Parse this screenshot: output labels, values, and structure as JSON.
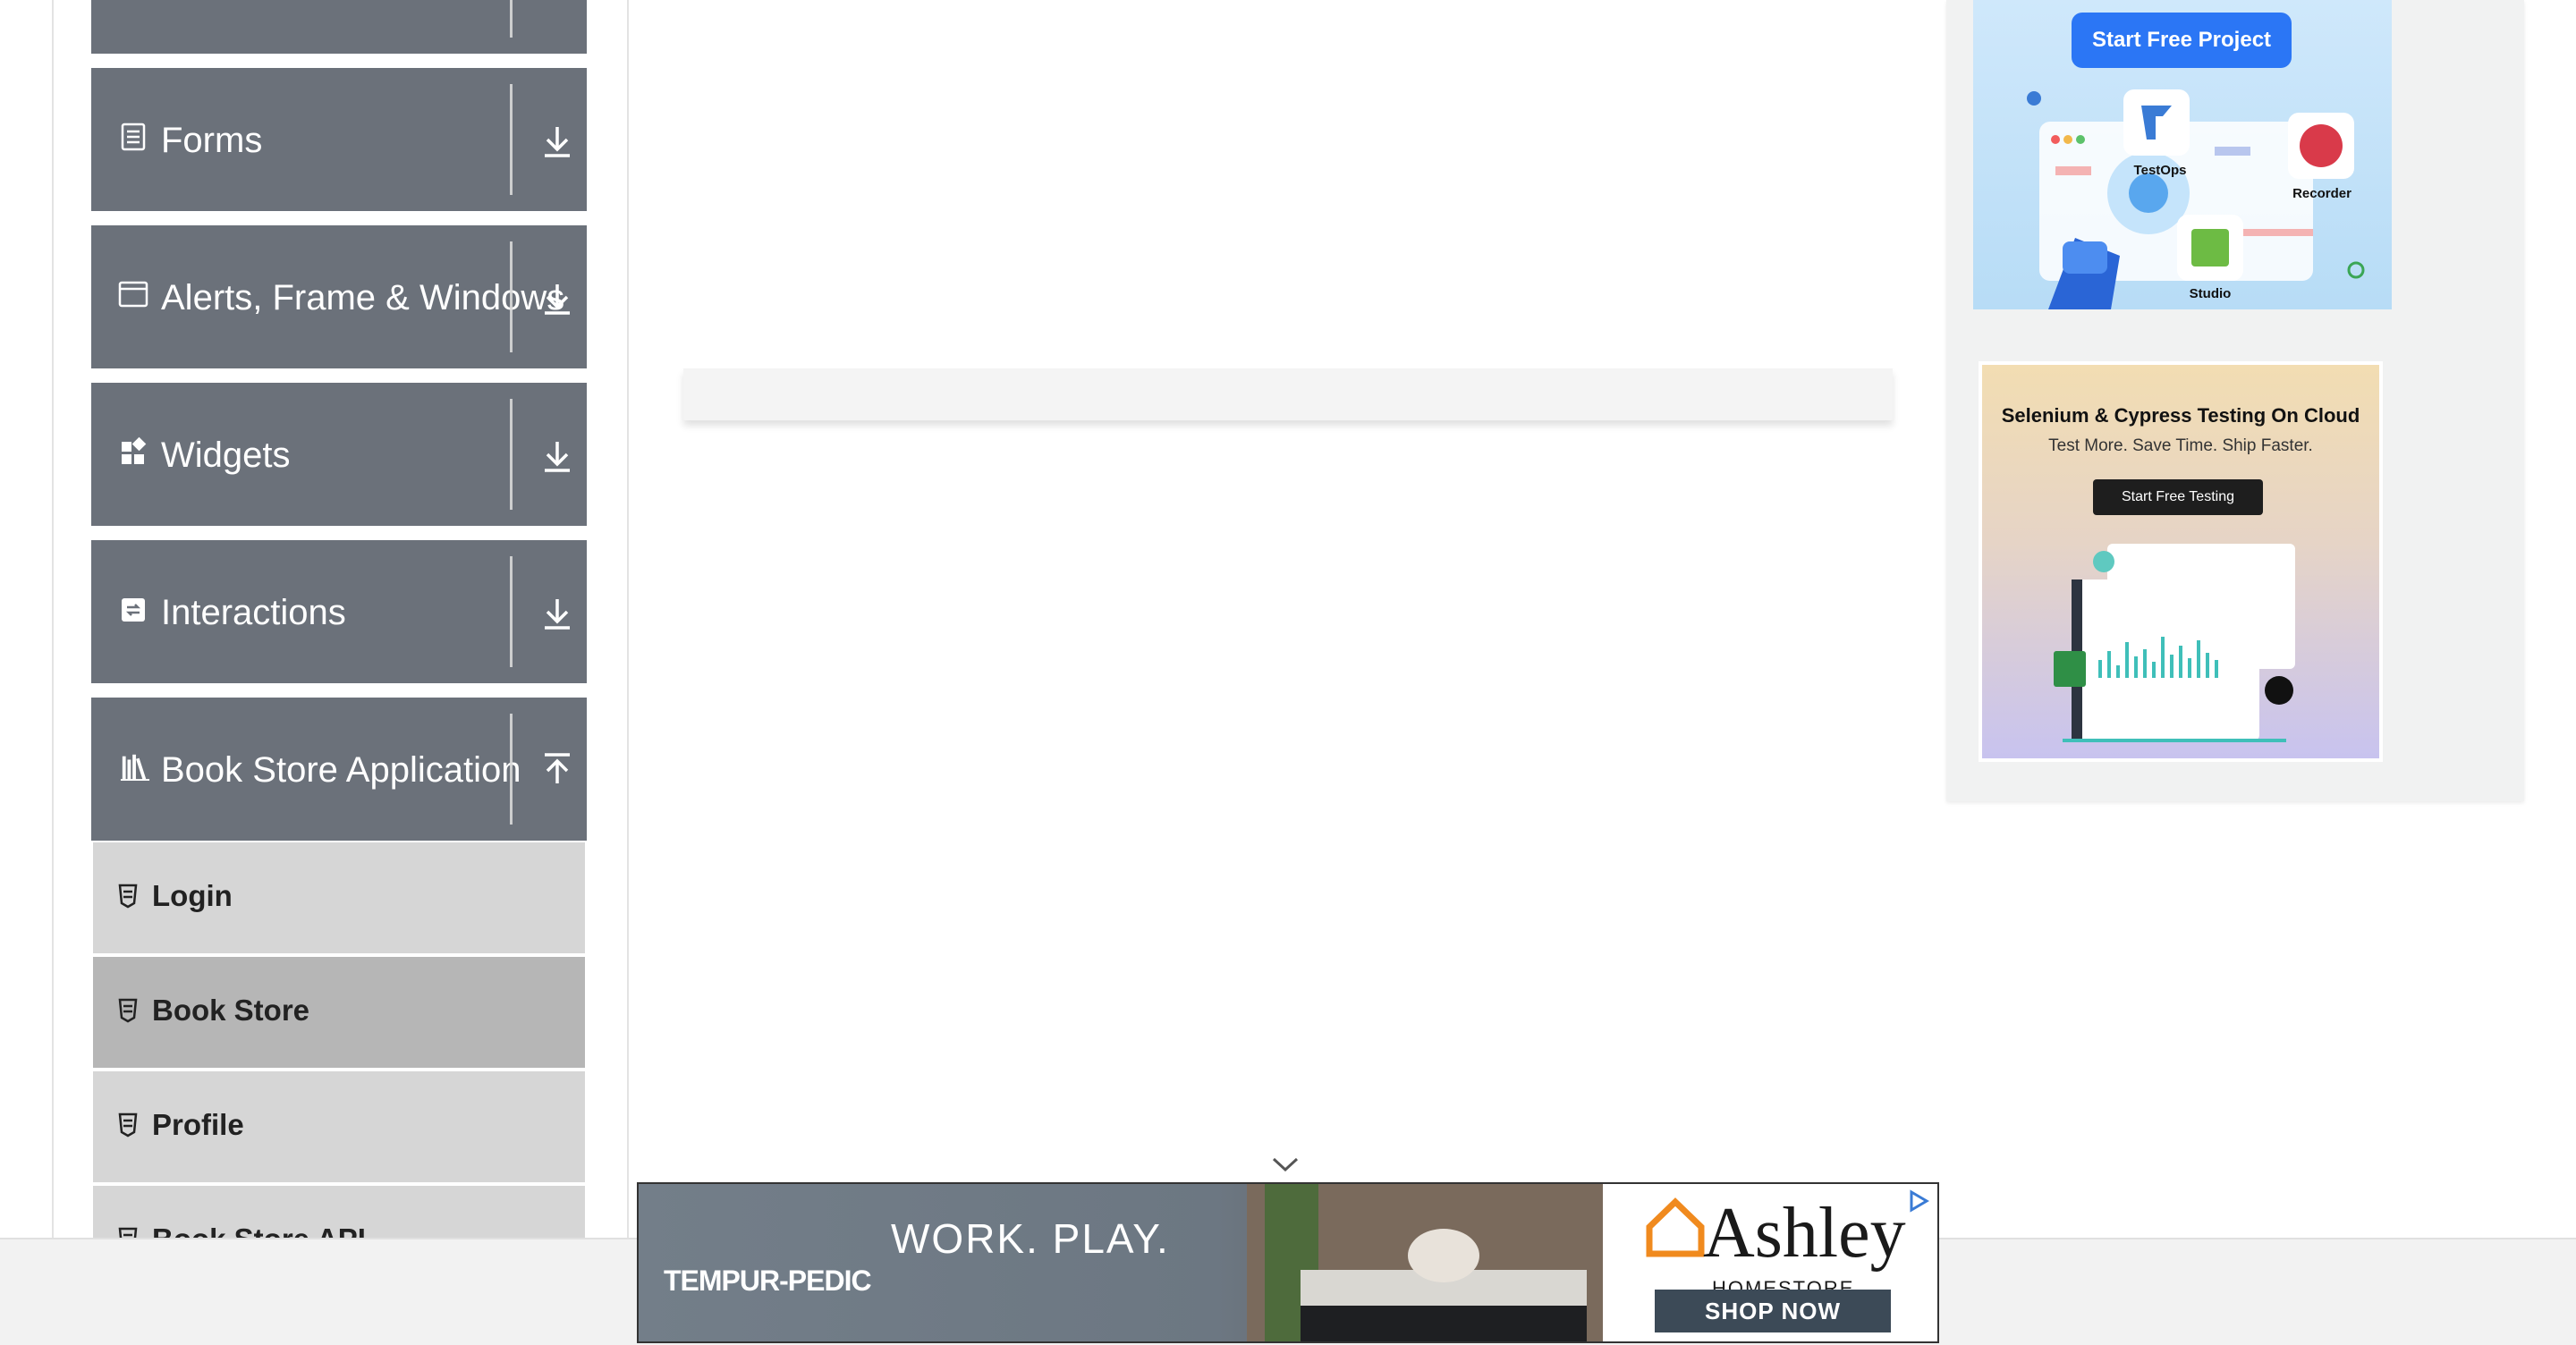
{
  "sidebar": {
    "groups": [
      {
        "label": "Forms",
        "icon": "document-icon"
      },
      {
        "label": "Alerts, Frame & Windows",
        "icon": "window-icon"
      },
      {
        "label": "Widgets",
        "icon": "widgets-icon"
      },
      {
        "label": "Interactions",
        "icon": "interactions-icon"
      },
      {
        "label": "Book Store Application",
        "icon": "books-icon",
        "expanded": true
      }
    ],
    "bookstore_items": [
      {
        "label": "Login"
      },
      {
        "label": "Book Store",
        "active": true
      },
      {
        "label": "Profile"
      },
      {
        "label": "Book Store API"
      }
    ]
  },
  "ads": {
    "katalon": {
      "button": "Start Free Project",
      "apps": [
        "TestOps",
        "Recorder",
        "Studio"
      ]
    },
    "lambdatest": {
      "title": "Selenium & Cypress Testing On Cloud",
      "subtitle": "Test More. Save Time. Ship Faster.",
      "button": "Start Free Testing"
    },
    "banner": {
      "headline": "WORK. PLAY.",
      "brand": "TEMPUR-PEDIC",
      "ashley": "Ashley",
      "homestore": "HOMESTORE",
      "cta": "SHOP NOW"
    }
  },
  "colors": {
    "group_bg": "#6b717a",
    "subitem_bg": "#d6d6d6",
    "subitem_active_bg": "#b6b6b6",
    "katalon_button": "#2b76f5"
  }
}
